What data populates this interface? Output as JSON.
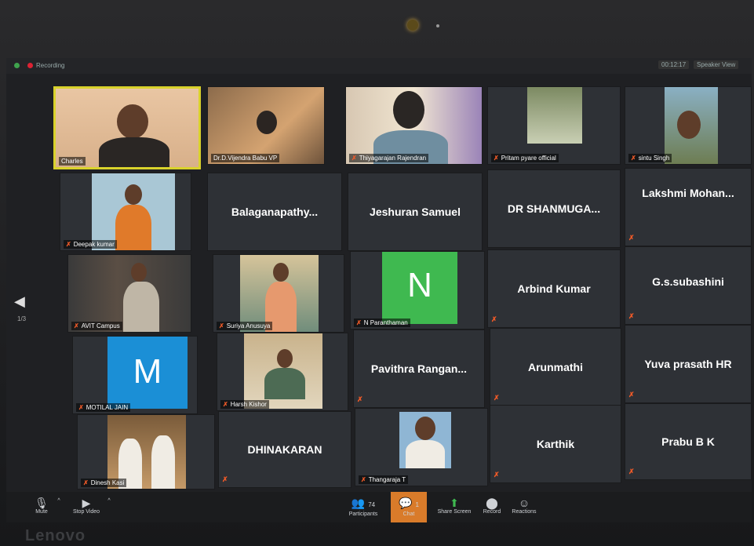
{
  "topbar": {
    "recording": "Recording",
    "page_indicator": "00:12:17",
    "speaker_view": "Speaker View"
  },
  "nav": {
    "page": "1/3"
  },
  "tiles": {
    "charles": "Charles",
    "vijendra": "Dr.D.Vijendra Babu VP",
    "thiyagarajan": "Thiyagarajan Rajendran",
    "pritam": "Pritam pyare official",
    "sintu": "sintu Singh",
    "deepak": "Deepak kumar",
    "balaganapathy": "Balaganapathy...",
    "jeshuran": "Jeshuran Samuel",
    "shanmuga": "DR SHANMUGA...",
    "lakshmi": "Lakshmi Mohan...",
    "avit": "AVIT Campus",
    "suriya": "Suriya Anusuya",
    "paranthaman": "N Paranthaman",
    "paranthaman_initial": "N",
    "arbind": "Arbind Kumar",
    "subashini": "G.s.subashini",
    "motilal": "MOTILAL JAIN",
    "motilal_initial": "M",
    "harsh": "Harsh Kishor",
    "pavithra": "Pavithra Rangan...",
    "arunmathi": "Arunmathi",
    "yuva": "Yuva prasath HR",
    "dinesh": "Dinesh Kasi",
    "dhinakaran": "DHINAKARAN",
    "thangaraja": "Thangaraja T",
    "karthik": "Karthik",
    "prabu": "Prabu B K"
  },
  "toolbar": {
    "mute": "Mute",
    "stop_video": "Stop Video",
    "participants": "Participants",
    "participants_count": "74",
    "chat": "Chat",
    "chat_count": "1",
    "share_screen": "Share Screen",
    "record": "Record",
    "reactions": "Reactions"
  },
  "brand": "Lenovo",
  "colors": {
    "active_border": "#d9d22b",
    "share_green": "#3fb950",
    "chat_orange": "#d97b2a",
    "mute_red": "#f05a28",
    "n_avatar": "#3fb950",
    "m_avatar": "#1b8fd6"
  }
}
